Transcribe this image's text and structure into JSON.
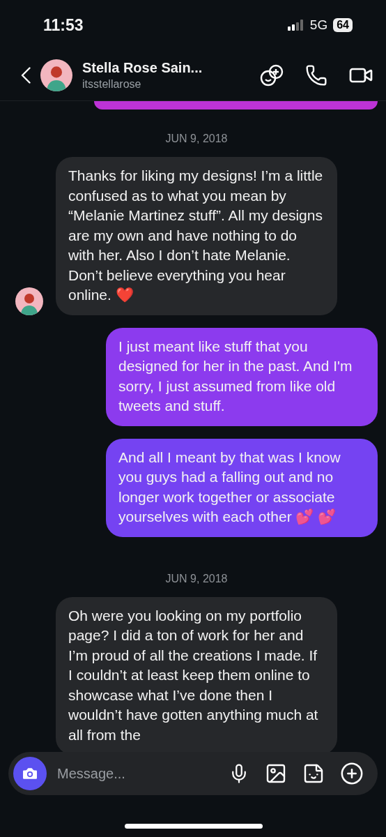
{
  "status_bar": {
    "time": "11:53",
    "network": "5G",
    "battery": "64"
  },
  "header": {
    "name": "Stella Rose Sain...",
    "username": "itsstellarose"
  },
  "messages": [
    {
      "kind": "sent_cut",
      "color": "#bd33d6"
    },
    {
      "kind": "date",
      "text": "JUN 9, 2018"
    },
    {
      "kind": "received",
      "avatar": true,
      "text": "Thanks for liking my designs! I’m a little confused as to what you mean by “Melanie Martinez stuff”. All my designs are my own and have nothing to do with her. Also I don’t hate Melanie. Don’t believe everything you hear online. ❤️"
    },
    {
      "kind": "sent",
      "color": "#8c3bee",
      "text": "I just meant like stuff that you designed for her in the past. And I'm sorry, I just assumed from like old tweets and stuff."
    },
    {
      "kind": "sent",
      "color": "#7543f2",
      "text": "And all I meant by that was I know you guys had a falling out and no longer work together or associate yourselves with each other 💕 💕"
    },
    {
      "kind": "date",
      "text": "JUN 9, 2018"
    },
    {
      "kind": "received",
      "avatar": false,
      "text": "Oh were you looking on my portfolio page? I did a ton of work for her and I’m proud of all the creations I made. If I couldn’t at least keep them online to showcase what I’ve done then I wouldn’t have gotten anything  much at all from the"
    }
  ],
  "composer": {
    "placeholder": "Message..."
  }
}
